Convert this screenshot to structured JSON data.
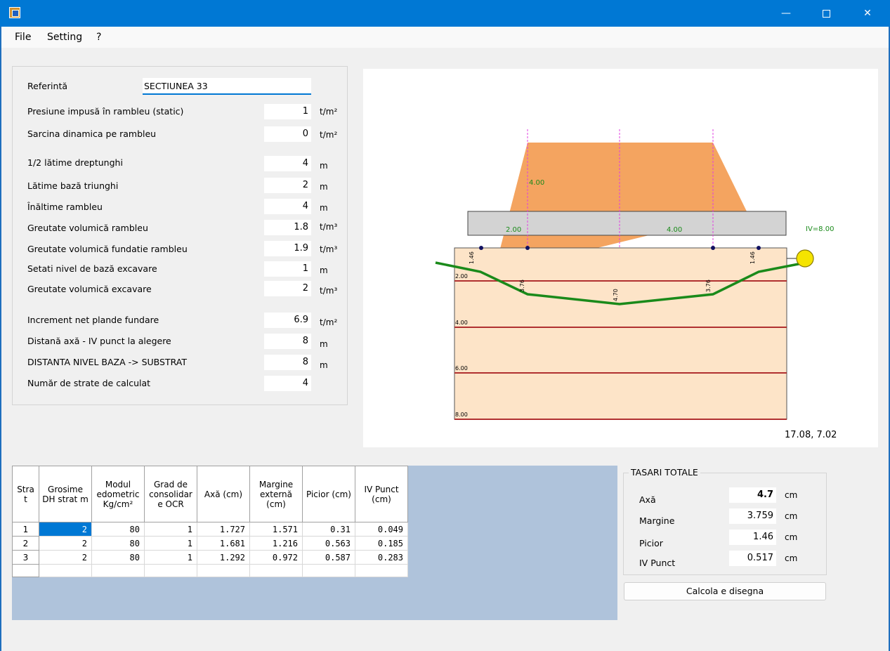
{
  "window": {
    "min_glyph": "—",
    "close_glyph": "✕"
  },
  "menu": [
    "File",
    "Setting",
    "?"
  ],
  "reference": {
    "label": "Referintă",
    "value": "SECTIUNEA 33"
  },
  "params": [
    {
      "label": "Presiune impusă în rambleu (static)",
      "value": "1",
      "unit": "t/m²"
    },
    {
      "label": "Sarcina dinamica pe rambleu",
      "value": "0",
      "unit": "t/m²"
    },
    {
      "label": "1/2 lătime dreptunghi",
      "value": "4",
      "unit": "m"
    },
    {
      "label": "Lătime bază triunghi",
      "value": "2",
      "unit": "m"
    },
    {
      "label": "Înăltime rambleu",
      "value": "4",
      "unit": "m"
    },
    {
      "label": "Greutate volumică rambleu",
      "value": "1.8",
      "unit": "t/m³"
    },
    {
      "label": "Greutate volumică fundatie rambleu",
      "value": "1.9",
      "unit": "t/m³"
    },
    {
      "label": "Setati nivel de bază excavare",
      "value": "1",
      "unit": "m"
    },
    {
      "label": "Greutate volumică excavare",
      "value": "2",
      "unit": "t/m³"
    },
    {
      "label": "Increment net plande fundare",
      "value": "6.9",
      "unit": "t/m²"
    },
    {
      "label": "Distană axă - IV punct la alegere",
      "value": "8",
      "unit": "m"
    },
    {
      "label": "DISTANTA NIVEL BAZA -> SUBSTRAT",
      "value": "8",
      "unit": "m"
    },
    {
      "label": "Număr de strate de calculat",
      "value": "4",
      "unit": ""
    }
  ],
  "drawing": {
    "height_label": "4.00",
    "base_label_left": "2.00",
    "base_label_right": "4.00",
    "iv_label": "IV=8.00",
    "depth_labels": [
      "2.00",
      "4.00",
      "6.00",
      "8.00"
    ],
    "settlement_labels": [
      "1.46",
      "3.76",
      "4.70",
      "3.76",
      "1.46"
    ],
    "coord_readout": "17.08, 7.02",
    "colors": {
      "embankment": "#f4a460",
      "base": "#d3d3d3",
      "soil": "#fde4c8",
      "layer_line": "#b03030",
      "settlement_curve": "#1a8a1a",
      "axis_marks": "#e040e0",
      "marker": "#f5e400"
    }
  },
  "table": {
    "headers": [
      "Stra t",
      "Grosime DH strat m",
      "Modul edometric Kg/cm²",
      "Grad de consolidar e OCR",
      "Axă (cm)",
      "Margine externă (cm)",
      "Picior (cm)",
      "IV Punct (cm)"
    ],
    "rows": [
      [
        "1",
        "2",
        "80",
        "1",
        "1.727",
        "1.571",
        "0.31",
        "0.049"
      ],
      [
        "2",
        "2",
        "80",
        "1",
        "1.681",
        "1.216",
        "0.563",
        "0.185"
      ],
      [
        "3",
        "2",
        "80",
        "1",
        "1.292",
        "0.972",
        "0.587",
        "0.283"
      ]
    ]
  },
  "totals": {
    "title": "TASARI TOTALE",
    "items": [
      {
        "label": "Axă",
        "value": "4.7",
        "unit": "cm"
      },
      {
        "label": "Margine",
        "value": "3.759",
        "unit": "cm"
      },
      {
        "label": "Picior",
        "value": "1.46",
        "unit": "cm"
      },
      {
        "label": "IV Punct",
        "value": "0.517",
        "unit": "cm"
      }
    ]
  },
  "calc_button": "Calcola e disegna"
}
